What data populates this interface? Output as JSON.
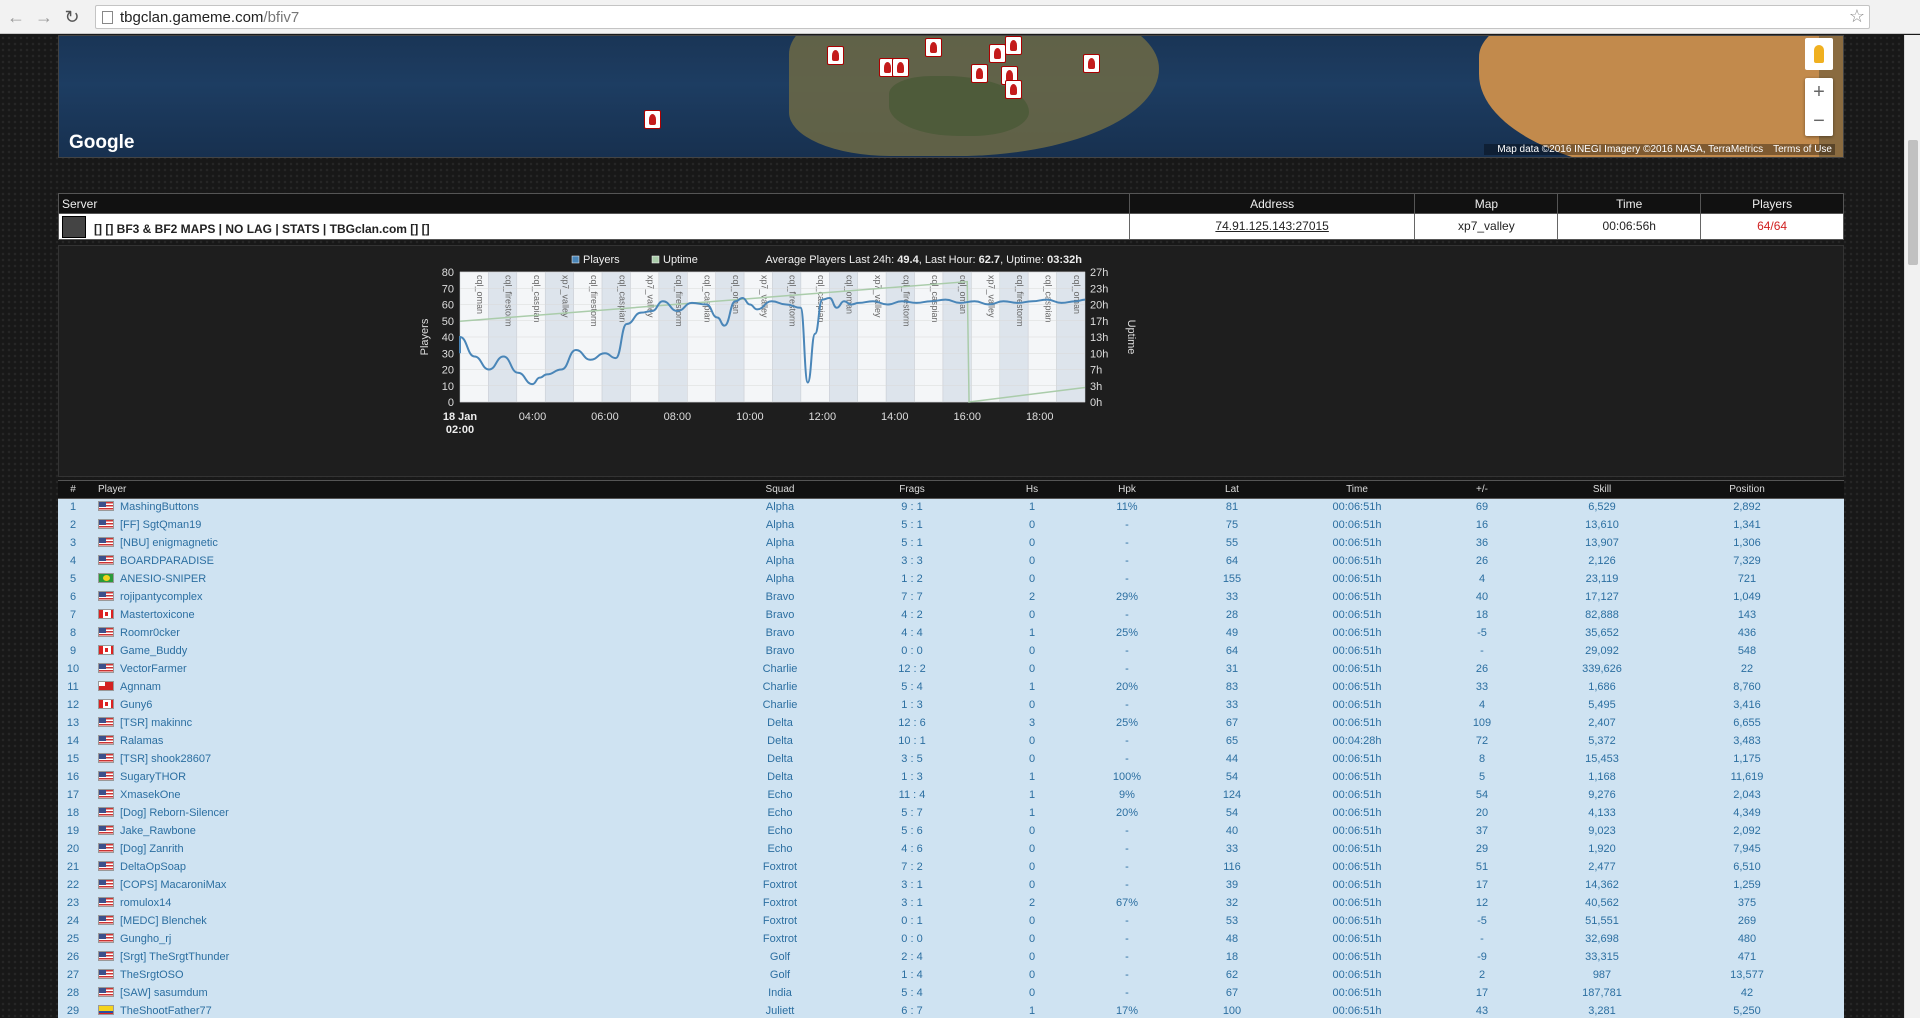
{
  "browser": {
    "url_host": "tbgclan.gameme.com",
    "url_path": "/bfiv7"
  },
  "map": {
    "brand": "Google",
    "attribution": "Map data ©2016 INEGI Imagery ©2016 NASA, TerraMetrics",
    "terms": "Terms of Use",
    "zoom_in": "+",
    "zoom_out": "−"
  },
  "server_table": {
    "headers": {
      "server": "Server",
      "address": "Address",
      "map": "Map",
      "time": "Time",
      "players": "Players"
    },
    "name": "[] [] BF3 & BF2 MAPS | NO LAG | STATS | TBGclan.com [] []",
    "address": "74.91.125.143:27015",
    "map": "xp7_valley",
    "time": "00:06:56h",
    "players": "64/64"
  },
  "chart": {
    "legend_players": "Players",
    "legend_uptime": "Uptime",
    "summary_prefix": "Average Players Last 24h:",
    "summary_avg": "49.4",
    "summary_lasthour_label": "Last Hour:",
    "summary_lasthour": "62.7",
    "summary_uptime_label": "Uptime:",
    "summary_uptime": "03:32h",
    "ylabel_left": "Players",
    "ylabel_right": "Uptime"
  },
  "chart_data": {
    "type": "line",
    "title": "",
    "xlabel": "",
    "ylabel": "Players",
    "ylabel_right": "Uptime",
    "ylim": [
      0,
      80
    ],
    "yticks": [
      0,
      10,
      20,
      30,
      40,
      50,
      60,
      70,
      80
    ],
    "yticks_right": [
      "0h",
      "3h",
      "7h",
      "10h",
      "13h",
      "17h",
      "20h",
      "23h",
      "27h"
    ],
    "xticks": [
      "18 Jan 02:00",
      "04:00",
      "06:00",
      "08:00",
      "10:00",
      "12:00",
      "14:00",
      "16:00",
      "18:00"
    ],
    "xlim_hours": [
      2,
      19.25
    ],
    "series": [
      {
        "name": "Players",
        "color": "#4a86b8",
        "x": [
          1.6,
          2.0,
          2.4,
          2.8,
          3.2,
          3.6,
          4.0,
          4.2,
          4.4,
          4.8,
          5.2,
          5.6,
          6.0,
          6.3,
          6.6,
          7.0,
          7.3,
          7.6,
          8.0,
          8.4,
          8.8,
          9.1,
          9.3,
          9.6,
          9.8,
          10.0,
          10.2,
          10.6,
          11.0,
          11.4,
          11.6,
          11.8,
          12.0,
          12.2,
          12.4,
          12.6,
          12.8,
          13.0,
          13.4,
          13.8,
          14.2,
          14.6,
          15.0,
          15.4,
          15.8,
          16.2,
          16.6,
          17.0,
          17.4,
          17.8,
          18.2,
          18.6,
          19.0,
          19.25
        ],
        "values": [
          30,
          40,
          28,
          20,
          28,
          18,
          11,
          15,
          17,
          20,
          32,
          26,
          30,
          27,
          48,
          55,
          56,
          62,
          56,
          61,
          60,
          52,
          47,
          62,
          64,
          60,
          57,
          62,
          60,
          58,
          12,
          42,
          63,
          64,
          58,
          62,
          60,
          61,
          62,
          60,
          62,
          61,
          62,
          63,
          61,
          62,
          60,
          62,
          61,
          62,
          63,
          61,
          62,
          63
        ]
      },
      {
        "name": "Uptime",
        "color": "#aaccaa",
        "x": [
          1.6,
          16.0,
          16.05,
          19.25
        ],
        "values_hours": [
          17,
          25,
          0,
          3
        ]
      }
    ],
    "map_bands": [
      "cql_oman",
      "cql_firestorm",
      "cql_caspian",
      "xp7_valley",
      "cql_firestorm",
      "cql_caspian",
      "xp7_valley",
      "cql_firestorm",
      "cql_caspian",
      "cql_oman",
      "xp7_valley",
      "cql_firestorm",
      "cql_caspian",
      "cql_oman",
      "xp7_valley",
      "cql_firestorm",
      "cql_caspian",
      "cql_oman",
      "xp7_valley",
      "cql_firestorm",
      "cql_caspian",
      "cql_oman"
    ]
  },
  "players_table": {
    "headers": [
      "#",
      "Player",
      "Squad",
      "Frags",
      "Hs",
      "Hpk",
      "Lat",
      "Time",
      "+/-",
      "Skill",
      "Position"
    ],
    "rows": [
      {
        "n": "1",
        "flag": "us",
        "name": "MashingButtons",
        "squad": "Alpha",
        "frags": "9  :  1",
        "hs": "1",
        "hpk": "11%",
        "lat": "81",
        "time": "00:06:51h",
        "pm": "69",
        "skill": "6,529",
        "pos": "2,892"
      },
      {
        "n": "2",
        "flag": "us",
        "name": "[FF] SgtQman19",
        "squad": "Alpha",
        "frags": "5  :  1",
        "hs": "0",
        "hpk": "-",
        "lat": "75",
        "time": "00:06:51h",
        "pm": "16",
        "skill": "13,610",
        "pos": "1,341"
      },
      {
        "n": "3",
        "flag": "us",
        "name": "[NBU] enigmagnetic",
        "squad": "Alpha",
        "frags": "5  :  1",
        "hs": "0",
        "hpk": "-",
        "lat": "55",
        "time": "00:06:51h",
        "pm": "36",
        "skill": "13,907",
        "pos": "1,306"
      },
      {
        "n": "4",
        "flag": "us",
        "name": "BOARDPARADISE",
        "squad": "Alpha",
        "frags": "3  :  3",
        "hs": "0",
        "hpk": "-",
        "lat": "64",
        "time": "00:06:51h",
        "pm": "26",
        "skill": "2,126",
        "pos": "7,329"
      },
      {
        "n": "5",
        "flag": "br",
        "name": "ANESIO-SNIPER",
        "squad": "Alpha",
        "frags": "1  :  2",
        "hs": "0",
        "hpk": "-",
        "lat": "155",
        "time": "00:06:51h",
        "pm": "4",
        "skill": "23,119",
        "pos": "721"
      },
      {
        "n": "6",
        "flag": "us",
        "name": "rojipantycomplex",
        "squad": "Bravo",
        "frags": "7  :  7",
        "hs": "2",
        "hpk": "29%",
        "lat": "33",
        "time": "00:06:51h",
        "pm": "40",
        "skill": "17,127",
        "pos": "1,049"
      },
      {
        "n": "7",
        "flag": "ca",
        "name": "Mastertoxicone",
        "squad": "Bravo",
        "frags": "4  :  2",
        "hs": "0",
        "hpk": "-",
        "lat": "28",
        "time": "00:06:51h",
        "pm": "18",
        "skill": "82,888",
        "pos": "143"
      },
      {
        "n": "8",
        "flag": "us",
        "name": "Roomr0cker",
        "squad": "Bravo",
        "frags": "4  :  4",
        "hs": "1",
        "hpk": "25%",
        "lat": "49",
        "time": "00:06:51h",
        "pm": "-5",
        "skill": "35,652",
        "pos": "436"
      },
      {
        "n": "9",
        "flag": "ca",
        "name": "Game_Buddy",
        "squad": "Bravo",
        "frags": "0  :  0",
        "hs": "0",
        "hpk": "-",
        "lat": "64",
        "time": "00:06:51h",
        "pm": "-",
        "skill": "29,092",
        "pos": "548"
      },
      {
        "n": "10",
        "flag": "us",
        "name": "VectorFarmer",
        "squad": "Charlie",
        "frags": "12  :  2",
        "hs": "0",
        "hpk": "-",
        "lat": "31",
        "time": "00:06:51h",
        "pm": "26",
        "skill": "339,626",
        "pos": "22"
      },
      {
        "n": "11",
        "flag": "to",
        "name": "Agnnam",
        "squad": "Charlie",
        "frags": "5  :  4",
        "hs": "1",
        "hpk": "20%",
        "lat": "83",
        "time": "00:06:51h",
        "pm": "33",
        "skill": "1,686",
        "pos": "8,760"
      },
      {
        "n": "12",
        "flag": "ca",
        "name": "Guny6",
        "squad": "Charlie",
        "frags": "1  :  3",
        "hs": "0",
        "hpk": "-",
        "lat": "33",
        "time": "00:06:51h",
        "pm": "4",
        "skill": "5,495",
        "pos": "3,416"
      },
      {
        "n": "13",
        "flag": "us",
        "name": "[TSR] makinnc",
        "squad": "Delta",
        "frags": "12  :  6",
        "hs": "3",
        "hpk": "25%",
        "lat": "67",
        "time": "00:06:51h",
        "pm": "109",
        "skill": "2,407",
        "pos": "6,655"
      },
      {
        "n": "14",
        "flag": "us",
        "name": "Ralamas",
        "squad": "Delta",
        "frags": "10  :  1",
        "hs": "0",
        "hpk": "-",
        "lat": "65",
        "time": "00:04:28h",
        "pm": "72",
        "skill": "5,372",
        "pos": "3,483"
      },
      {
        "n": "15",
        "flag": "us",
        "name": "[TSR] shook28607",
        "squad": "Delta",
        "frags": "3  :  5",
        "hs": "0",
        "hpk": "-",
        "lat": "44",
        "time": "00:06:51h",
        "pm": "8",
        "skill": "15,453",
        "pos": "1,175"
      },
      {
        "n": "16",
        "flag": "us",
        "name": "SugaryTHOR",
        "squad": "Delta",
        "frags": "1  :  3",
        "hs": "1",
        "hpk": "100%",
        "lat": "54",
        "time": "00:06:51h",
        "pm": "5",
        "skill": "1,168",
        "pos": "11,619"
      },
      {
        "n": "17",
        "flag": "us",
        "name": "XmasekOne",
        "squad": "Echo",
        "frags": "11  :  4",
        "hs": "1",
        "hpk": "9%",
        "lat": "124",
        "time": "00:06:51h",
        "pm": "54",
        "skill": "9,276",
        "pos": "2,043"
      },
      {
        "n": "18",
        "flag": "us",
        "name": "[Dog] Reborn-Silencer",
        "squad": "Echo",
        "frags": "5  :  7",
        "hs": "1",
        "hpk": "20%",
        "lat": "54",
        "time": "00:06:51h",
        "pm": "20",
        "skill": "4,133",
        "pos": "4,349"
      },
      {
        "n": "19",
        "flag": "us",
        "name": "Jake_Rawbone",
        "squad": "Echo",
        "frags": "5  :  6",
        "hs": "0",
        "hpk": "-",
        "lat": "40",
        "time": "00:06:51h",
        "pm": "37",
        "skill": "9,023",
        "pos": "2,092"
      },
      {
        "n": "20",
        "flag": "us",
        "name": "[Dog] Zanrith",
        "squad": "Echo",
        "frags": "4  :  6",
        "hs": "0",
        "hpk": "-",
        "lat": "33",
        "time": "00:06:51h",
        "pm": "29",
        "skill": "1,920",
        "pos": "7,945"
      },
      {
        "n": "21",
        "flag": "us",
        "name": "DeltaOpSoap",
        "squad": "Foxtrot",
        "frags": "7  :  2",
        "hs": "0",
        "hpk": "-",
        "lat": "116",
        "time": "00:06:51h",
        "pm": "51",
        "skill": "2,477",
        "pos": "6,510"
      },
      {
        "n": "22",
        "flag": "us",
        "name": "[COPS] MacaroniMax",
        "squad": "Foxtrot",
        "frags": "3  :  1",
        "hs": "0",
        "hpk": "-",
        "lat": "39",
        "time": "00:06:51h",
        "pm": "17",
        "skill": "14,362",
        "pos": "1,259"
      },
      {
        "n": "23",
        "flag": "us",
        "name": "romulox14",
        "squad": "Foxtrot",
        "frags": "3  :  1",
        "hs": "2",
        "hpk": "67%",
        "lat": "32",
        "time": "00:06:51h",
        "pm": "12",
        "skill": "40,562",
        "pos": "375"
      },
      {
        "n": "24",
        "flag": "us",
        "name": "[MEDC] Blenchek",
        "squad": "Foxtrot",
        "frags": "0  :  1",
        "hs": "0",
        "hpk": "-",
        "lat": "53",
        "time": "00:06:51h",
        "pm": "-5",
        "skill": "51,551",
        "pos": "269"
      },
      {
        "n": "25",
        "flag": "us",
        "name": "Gungho_rj",
        "squad": "Foxtrot",
        "frags": "0  :  0",
        "hs": "0",
        "hpk": "-",
        "lat": "48",
        "time": "00:06:51h",
        "pm": "-",
        "skill": "32,698",
        "pos": "480"
      },
      {
        "n": "26",
        "flag": "us",
        "name": "[Srgt] TheSrgtThunder",
        "squad": "Golf",
        "frags": "2  :  4",
        "hs": "0",
        "hpk": "-",
        "lat": "18",
        "time": "00:06:51h",
        "pm": "-9",
        "skill": "33,315",
        "pos": "471"
      },
      {
        "n": "27",
        "flag": "us",
        "name": "TheSrgtOSO",
        "squad": "Golf",
        "frags": "1  :  4",
        "hs": "0",
        "hpk": "-",
        "lat": "62",
        "time": "00:06:51h",
        "pm": "2",
        "skill": "987",
        "pos": "13,577"
      },
      {
        "n": "28",
        "flag": "us",
        "name": "[SAW] sasumdum",
        "squad": "India",
        "frags": "5  :  4",
        "hs": "0",
        "hpk": "-",
        "lat": "67",
        "time": "00:06:51h",
        "pm": "17",
        "skill": "187,781",
        "pos": "42"
      },
      {
        "n": "29",
        "flag": "co",
        "name": "TheShootFather77",
        "squad": "Juliett",
        "frags": "6  :  7",
        "hs": "1",
        "hpk": "17%",
        "lat": "100",
        "time": "00:06:51h",
        "pm": "43",
        "skill": "3,281",
        "pos": "5,250"
      }
    ]
  }
}
